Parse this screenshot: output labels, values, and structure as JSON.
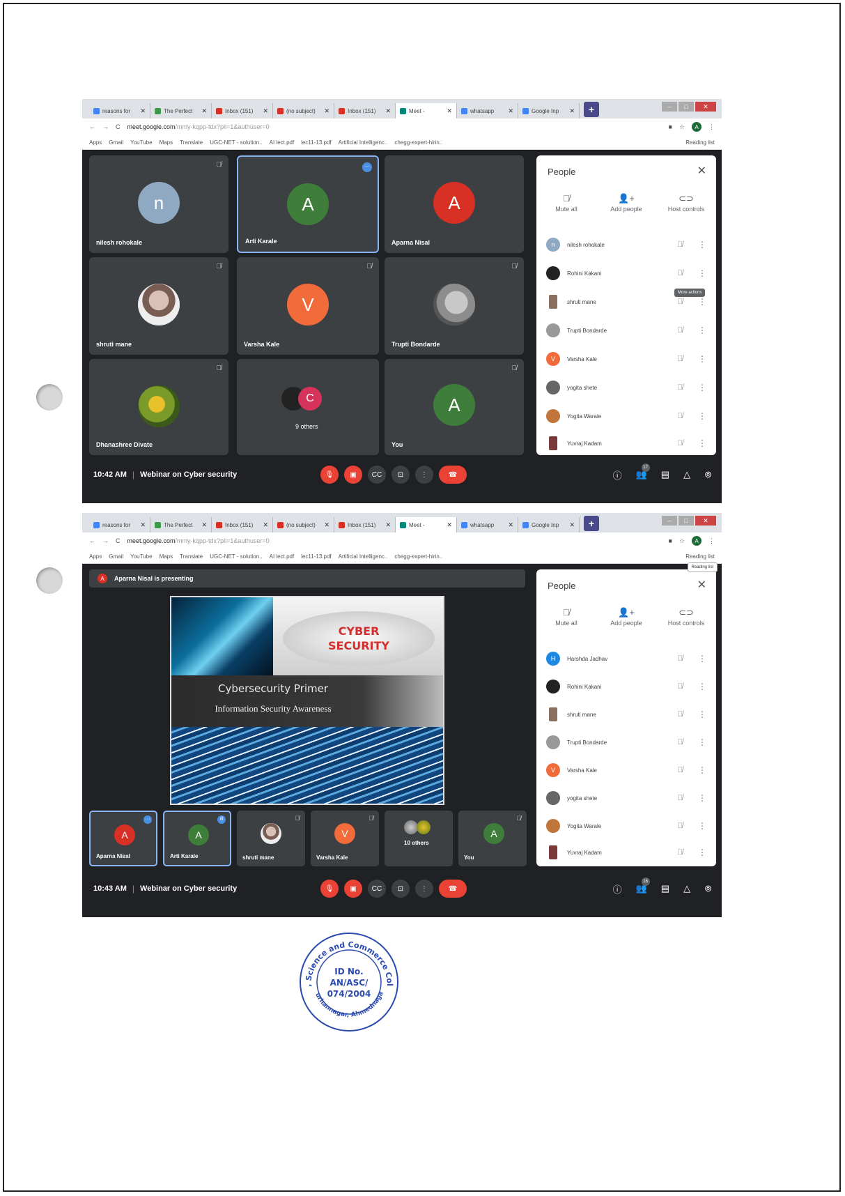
{
  "browser": {
    "tabs": [
      {
        "label": "reasons for",
        "color": "#4285f4"
      },
      {
        "label": "The Perfect",
        "color": "#3b9b4a"
      },
      {
        "label": "Inbox (151)",
        "color": "#d93025"
      },
      {
        "label": "(no subject)",
        "color": "#d93025"
      },
      {
        "label": "Inbox (151)",
        "color": "#d93025"
      },
      {
        "label": "Meet -",
        "color": "#00897b"
      },
      {
        "label": "whatsapp",
        "color": "#4285f4"
      },
      {
        "label": "Google Inp",
        "color": "#4285f4"
      }
    ],
    "url_host": "meet.google.com",
    "url_path": "/mmy-kqpp-tdx?pli=1&authuser=0",
    "account_initial": "A",
    "bookmarks": [
      "Apps",
      "Gmail",
      "YouTube",
      "Maps",
      "Translate",
      "UGC-NET - solution..",
      "AI lect.pdf",
      "lec11-13.pdf",
      "Artificial Intelligenc..",
      "chegg-expert-hirin.."
    ],
    "reading_list": "Reading list"
  },
  "screen1": {
    "tiles": [
      {
        "name": "nilesh rohokale",
        "initial": "n",
        "color": "#8fa9c2"
      },
      {
        "name": "Arti Karale",
        "initial": "A",
        "color": "#3f7e3a"
      },
      {
        "name": "Aparna Nisal",
        "initial": "A",
        "color": "#d93025"
      },
      {
        "name": "shruti mane",
        "initial": "",
        "color": ""
      },
      {
        "name": "Varsha Kale",
        "initial": "V",
        "color": "#f26b3a"
      },
      {
        "name": "Trupti Bondarde",
        "initial": "",
        "color": ""
      },
      {
        "name": "Dhanashree Divate",
        "initial": "",
        "color": ""
      },
      {
        "name": "9 others",
        "initial": "C",
        "color": "#d6335a"
      },
      {
        "name": "You",
        "initial": "A",
        "color": "#3f7e3a"
      }
    ],
    "time": "10:42 AM",
    "meeting": "Webinar on Cyber security",
    "people_count": "17",
    "tooltip": "More actions",
    "people": [
      {
        "name": "nilesh rohokale",
        "initial": "n",
        "color": "#8fa9c2"
      },
      {
        "name": "Rohini Kakani",
        "initial": "",
        "color": "#222"
      },
      {
        "name": "shruti mane",
        "initial": "",
        "color": "#8a7060"
      },
      {
        "name": "Trupti Bondarde",
        "initial": "",
        "color": "#999"
      },
      {
        "name": "Varsha Kale",
        "initial": "V",
        "color": "#f26b3a"
      },
      {
        "name": "yogita shete",
        "initial": "",
        "color": "#666"
      },
      {
        "name": "Yogita Waraie",
        "initial": "",
        "color": "#c0753a"
      },
      {
        "name": "Yuvraj Kadam",
        "initial": "",
        "color": "#7a3a3a"
      }
    ]
  },
  "screen2": {
    "presenting": "Aparna Nisal is presenting",
    "slide_title": "CYBER SECURITY",
    "slide_line1": "Cybersecurity Primer",
    "slide_line2": "Information Security Awareness",
    "tiles": [
      {
        "name": "Aparna Nisal",
        "initial": "A",
        "color": "#d93025"
      },
      {
        "name": "Arti Karale",
        "initial": "A",
        "color": "#3f7e3a"
      },
      {
        "name": "shruti mane",
        "initial": "",
        "color": ""
      },
      {
        "name": "Varsha Kale",
        "initial": "V",
        "color": "#f26b3a"
      },
      {
        "name": "10 others",
        "initial": "",
        "color": ""
      },
      {
        "name": "You",
        "initial": "A",
        "color": "#3f7e3a"
      }
    ],
    "time": "10:43 AM",
    "meeting": "Webinar on Cyber security",
    "people_count": "16",
    "tooltip": "Reading list",
    "people": [
      {
        "name": "Harshda Jadhav",
        "initial": "H",
        "color": "#1e88e5"
      },
      {
        "name": "Rohini Kakani",
        "initial": "",
        "color": "#222"
      },
      {
        "name": "shruti mane",
        "initial": "",
        "color": "#8a7060"
      },
      {
        "name": "Trupti Bondarde",
        "initial": "",
        "color": "#999"
      },
      {
        "name": "Varsha Kale",
        "initial": "V",
        "color": "#f26b3a"
      },
      {
        "name": "yogita shete",
        "initial": "",
        "color": "#666"
      },
      {
        "name": "Yogita Warale",
        "initial": "",
        "color": "#c0753a"
      },
      {
        "name": "Yuvraj Kadam",
        "initial": "",
        "color": "#7a3a3a"
      }
    ]
  },
  "people_panel": {
    "title": "People",
    "mute_all": "Mute all",
    "add_people": "Add people",
    "host_controls": "Host controls"
  },
  "stamp": {
    "arc_text": "Arts, Science and Commerce College",
    "bottom_text": "Burhannagar, Ahmednagar",
    "id_label": "ID No.",
    "id_line1": "AN/ASC/",
    "id_line2": "074/2004"
  }
}
